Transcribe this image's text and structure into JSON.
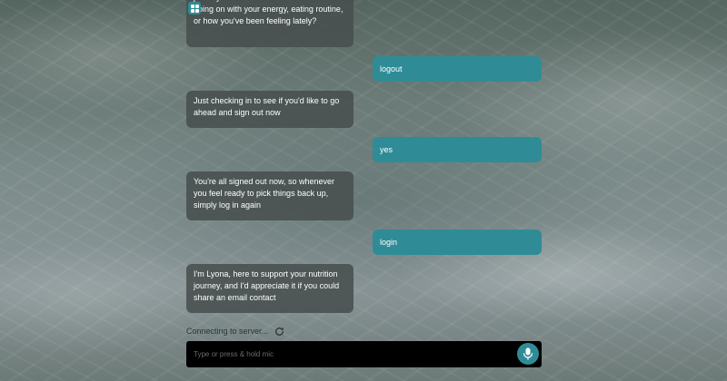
{
  "conversation": {
    "messages": [
      {
        "role": "bot",
        "text": "I'm Lyona, here to support your nutrition journey. Feel free to share what's been going on with your energy, eating routine, or how you've been feeling lately?"
      },
      {
        "role": "user",
        "text": "logout"
      },
      {
        "role": "bot",
        "text": "Just checking in to see if you'd like to go ahead and sign out now"
      },
      {
        "role": "user",
        "text": "yes"
      },
      {
        "role": "bot",
        "text": "You're all signed out now, so whenever you feel ready to pick things back up, simply log in again"
      },
      {
        "role": "user",
        "text": "login"
      },
      {
        "role": "bot",
        "text": "I'm Lyona, here to support your nutrition journey, and I'd appreciate it if you could share an email contact"
      }
    ]
  },
  "status": {
    "text": "Connecting to server..."
  },
  "composer": {
    "placeholder": "Type or press & hold mic"
  },
  "icons": {
    "logo": "grid-icon",
    "refresh": "refresh-icon",
    "mic": "microphone-icon"
  },
  "colors": {
    "accent": "#2f8c96",
    "bot_bubble": "#484e4e",
    "input_background": "#000000"
  }
}
